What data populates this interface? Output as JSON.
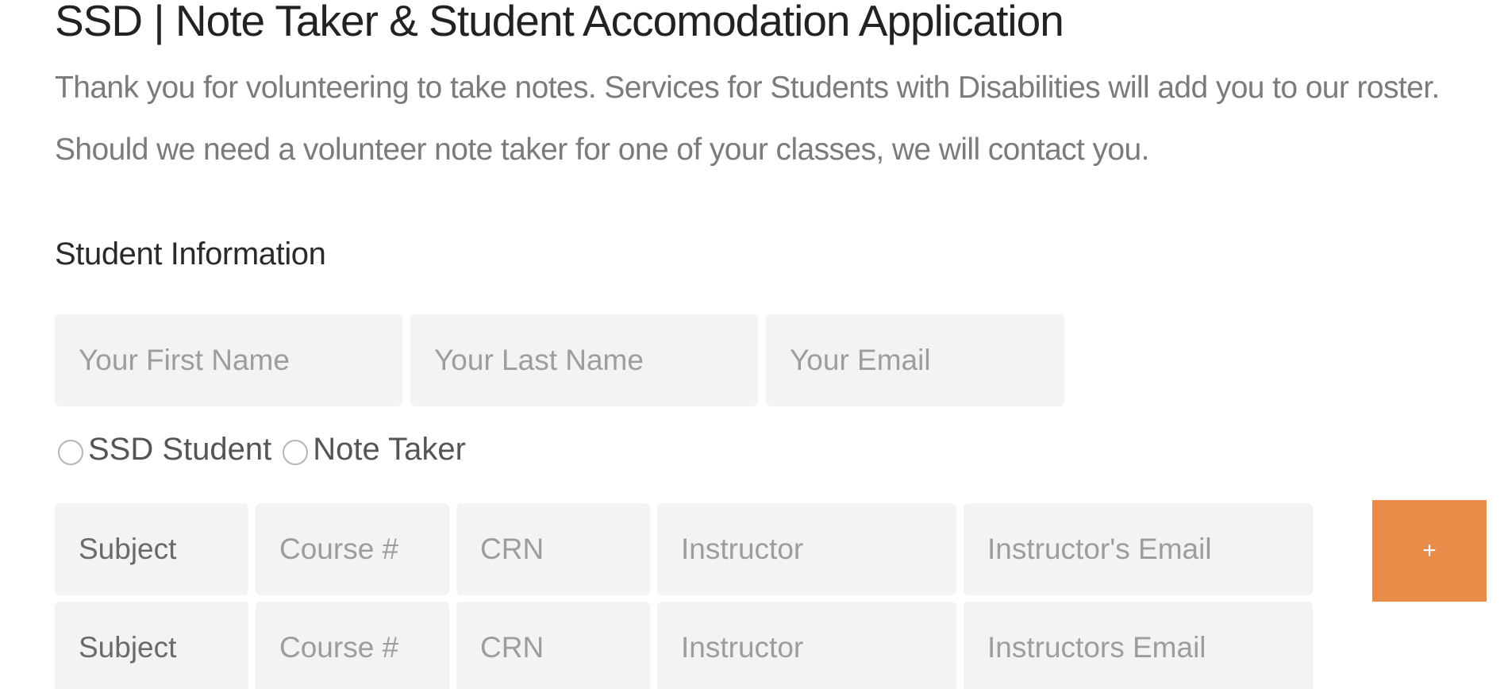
{
  "page": {
    "title": "SSD | Note Taker & Student Accomodation Application",
    "intro": "Thank you for volunteering to take notes. Services for Students with Disabilities will add you to our roster. Should we need a volunteer note taker for one of your classes, we will contact you."
  },
  "student_info": {
    "heading": "Student Information",
    "first_name_placeholder": "Your First Name",
    "last_name_placeholder": "Your Last Name",
    "email_placeholder": "Your Email",
    "radio_options": [
      {
        "label": "SSD Student"
      },
      {
        "label": "Note Taker"
      }
    ]
  },
  "course_rows": [
    {
      "subject": "Subject",
      "course_placeholder": "Course #",
      "crn_placeholder": "CRN",
      "instructor_placeholder": "Instructor",
      "instructor_email_placeholder": "Instructor's Email"
    },
    {
      "subject": "Subject",
      "course_placeholder": "Course #",
      "crn_placeholder": "CRN",
      "instructor_placeholder": "Instructor",
      "instructor_email_placeholder": "Instructors Email"
    }
  ],
  "add_button": {
    "label": "+"
  },
  "colors": {
    "accent": "#e98c4a",
    "field_background": "#f3f3f3",
    "intro_text": "#7b7b7b"
  }
}
